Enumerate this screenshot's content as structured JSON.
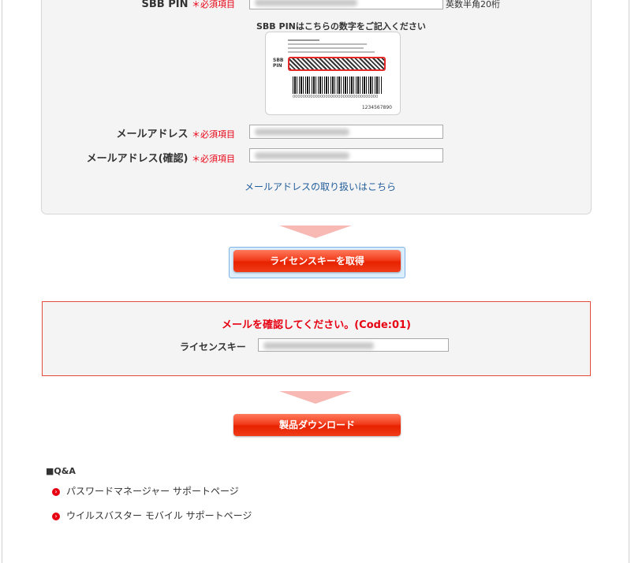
{
  "form": {
    "sbb_pin": {
      "label": "SBB PIN",
      "required": "＊必須項目",
      "hint": "英数半角20桁"
    },
    "pin_instruction": "SBB PINはこちらの数字をご記入ください",
    "card": {
      "pin_label": "SBB\nPIN",
      "barcode_digits": "0000000000000000000000000000000000",
      "number": "1234567890"
    },
    "email": {
      "label": "メールアドレス",
      "required": "＊必須項目"
    },
    "email_confirm": {
      "label": "メールアドレス(確認)",
      "required": "＊必須項目"
    },
    "email_policy_link": "メールアドレスの取り扱いはこちら"
  },
  "actions": {
    "get_license_label": "ライセンスキーを取得",
    "download_label": "製品ダウンロード"
  },
  "result": {
    "message": "メールを確認してください。(Code:01)",
    "license_label": "ライセンスキー"
  },
  "qa": {
    "heading": "■Q&A",
    "items": [
      {
        "label": "パスワードマネージャー サポートページ"
      },
      {
        "label": "ウイルスバスター モバイル サポートページ"
      }
    ]
  },
  "colors": {
    "required": "#e60012",
    "button": "#e72200",
    "link": "#1f5c9a",
    "alert_border": "#e54c3c",
    "arrow": "#f8b9b4"
  },
  "icons": {
    "qa_bullet": "chevron-right-circle-icon"
  }
}
